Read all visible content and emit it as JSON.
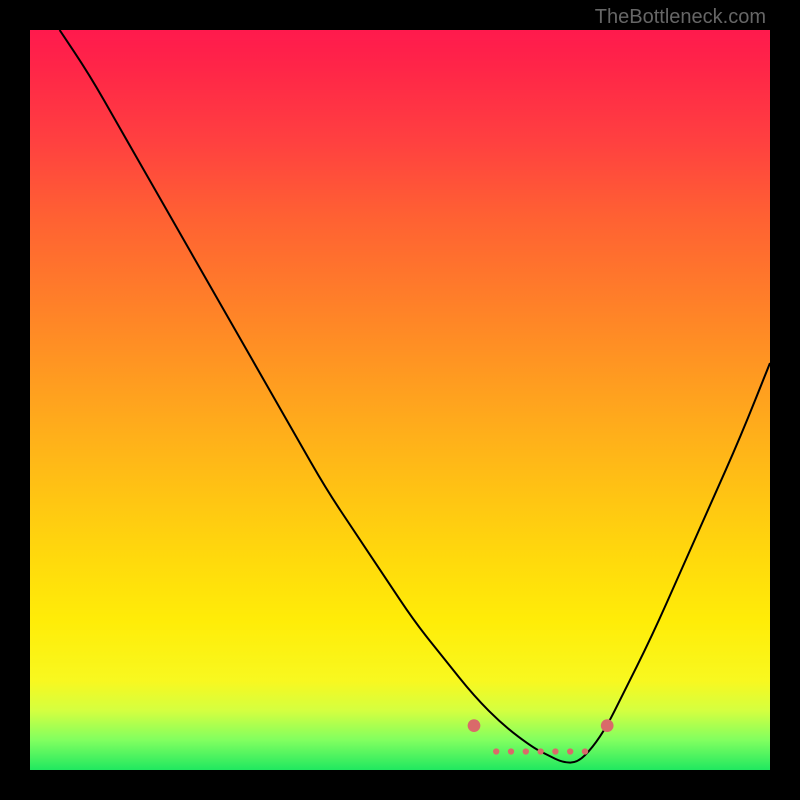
{
  "watermark": "TheBottleneck.com",
  "chart_data": {
    "type": "line",
    "title": "",
    "xlabel": "",
    "ylabel": "",
    "xlim": [
      0,
      100
    ],
    "ylim": [
      0,
      100
    ],
    "grid": false,
    "series": [
      {
        "name": "bottleneck-curve",
        "color": "#000000",
        "x": [
          4,
          8,
          12,
          16,
          20,
          24,
          28,
          32,
          36,
          40,
          44,
          48,
          52,
          56,
          60,
          64,
          68,
          70,
          72,
          74,
          76,
          78,
          80,
          84,
          88,
          92,
          96,
          100
        ],
        "y": [
          100,
          94,
          87,
          80,
          73,
          66,
          59,
          52,
          45,
          38,
          32,
          26,
          20,
          15,
          10,
          6,
          3,
          2,
          1,
          1,
          3,
          6,
          10,
          18,
          27,
          36,
          45,
          55
        ]
      }
    ],
    "markers": [
      {
        "name": "flat-region-start",
        "x": 60,
        "y": 6,
        "color": "#d96a6a",
        "size": 6
      },
      {
        "name": "flat-region-end",
        "x": 78,
        "y": 6,
        "color": "#d96a6a",
        "size": 6
      },
      {
        "name": "flat-region-dots",
        "xs": [
          63,
          65,
          67,
          69,
          71,
          73,
          75
        ],
        "y": 2.5,
        "color": "#d96a6a",
        "size": 3
      }
    ],
    "gradient_stops": [
      {
        "pos": 0,
        "color": "#ff1a4d"
      },
      {
        "pos": 15,
        "color": "#ff4040"
      },
      {
        "pos": 40,
        "color": "#ff8826"
      },
      {
        "pos": 70,
        "color": "#ffd60d"
      },
      {
        "pos": 88,
        "color": "#f8f820"
      },
      {
        "pos": 96,
        "color": "#80ff60"
      },
      {
        "pos": 100,
        "color": "#20e860"
      }
    ]
  }
}
